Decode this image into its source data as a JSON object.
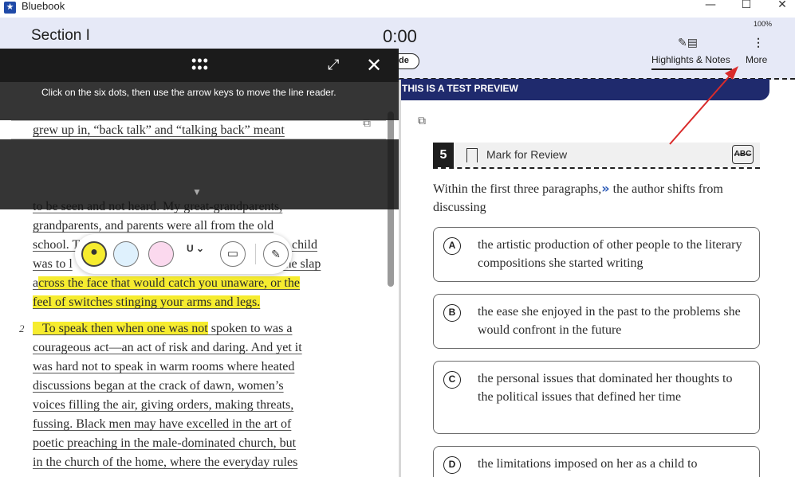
{
  "window": {
    "title": "Bluebook",
    "minimize": "—",
    "maximize": "☐",
    "close": "✕"
  },
  "header": {
    "section_title": "Section I",
    "timer": "0:00",
    "battery": "100%",
    "hide_label": "de",
    "highlights_notes_label": "Highlights & Notes",
    "more_label": "More"
  },
  "banner": {
    "text": "THIS IS A TEST PREVIEW"
  },
  "line_reader": {
    "instruction": "Click on the six dots, then use the arrow keys to move the line reader.",
    "dots": "⠿",
    "expand": "⤢",
    "close": "✕",
    "caret": "▼"
  },
  "passage": {
    "visible_lines": [
      {
        "text": "grew up in, “back talk” and “talking back” meant",
        "highlight": false
      },
      {
        "text": "to be seen and not heard. My great-grandparents,",
        "highlight": false
      },
      {
        "text": "grandparents, and parents were all from the old",
        "highlight": false
      },
      {
        "text": "school. T",
        "tail": "child",
        "highlight": false
      },
      {
        "text": "was to l",
        "tail": "g the slap",
        "highlight": false
      },
      {
        "pre": "a",
        "text": "cross the face that would catch you unaware, or the",
        "highlight": true
      },
      {
        "text": "feel of switches stinging your arms and legs.",
        "highlight": true
      }
    ],
    "para2_number": "2",
    "para2_lines": [
      {
        "hl": "To speak then when one was not",
        "rest": " spoken to was a"
      },
      {
        "text": "courageous act—an act of risk and daring. And yet it"
      },
      {
        "text": "was hard not to speak in warm rooms where heated"
      },
      {
        "text": "discussions began at the crack of dawn, women’s"
      },
      {
        "text": "voices filling the air, giving orders, making threats,"
      },
      {
        "text": "fussing. Black men may have excelled in the art of"
      },
      {
        "text": "poetic preaching in the male-dominated church, but"
      },
      {
        "text": "in the church of the home, where the everyday rules"
      }
    ]
  },
  "toolbar": {
    "underline_label": "U",
    "underline_caret": "⌄",
    "trash_icon": "🗑",
    "note_icon": "✎",
    "drop_icon": "💧"
  },
  "question": {
    "number": "5",
    "mark_label": "Mark for Review",
    "abc_label": "ABC",
    "stem_before": "Within the first three paragraphs,",
    "stem_glyph": "»",
    "stem_after": " the author shifts from discussing",
    "choices": [
      {
        "letter": "A",
        "text": "the artistic production of other people to the literary compositions she started writing"
      },
      {
        "letter": "B",
        "text": "the ease she enjoyed in the past to the problems she would confront in the future"
      },
      {
        "letter": "C",
        "text": "the personal issues that dominated her thoughts to the political issues that defined her time"
      },
      {
        "letter": "D",
        "text": "the limitations imposed on her as a child to"
      }
    ]
  },
  "colors": {
    "header_bg": "#e6e9f7",
    "banner_bg": "#1f2a6d",
    "highlight": "#f6ec2f",
    "annotation": "#d92b2b"
  }
}
